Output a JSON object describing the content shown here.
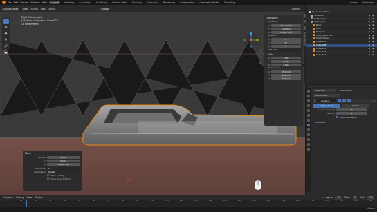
{
  "topbar": {
    "menus": [
      "File",
      "Edit",
      "Render",
      "Window",
      "Help"
    ],
    "workspaces": [
      "Layout",
      "Modeling",
      "Sculpting",
      "UV Editing",
      "Texture Paint",
      "Shading",
      "Animation",
      "Rendering",
      "Compositing",
      "Geometry Nodes",
      "Scripting"
    ],
    "active_workspace": "Layout",
    "scene": "Scene",
    "view_layer": "ViewLayer"
  },
  "viewport_header": {
    "mode": "Object Mode",
    "menus": [
      "View",
      "Select",
      "Add",
      "Object"
    ],
    "orientation": "Global",
    "options": "Options"
  },
  "viewport": {
    "view_name": "Right Orthographic",
    "collection": "(15) Scene Collection | Cube.008",
    "scale": "10 Centimeters"
  },
  "npanel": {
    "transform_title": "Transform",
    "location_label": "Location",
    "location": [
      {
        "axis": "X",
        "value": "-218.71 mm"
      },
      {
        "axis": "Y",
        "value": "-1.935 m"
      },
      {
        "axis": "Z",
        "value": "1208.7 mm"
      }
    ],
    "rotation_label": "Rotation",
    "rotation": [
      {
        "axis": "X",
        "value": "0°"
      },
      {
        "axis": "Y",
        "value": "0°"
      },
      {
        "axis": "Z",
        "value": "0°"
      }
    ],
    "rotation_mode": "XYZ Euler",
    "scale_label": "Scale",
    "scale": [
      {
        "axis": "X",
        "value": "1.867"
      },
      {
        "axis": "Y",
        "value": "0.788"
      },
      {
        "axis": "Z",
        "value": "2.666"
      }
    ],
    "dimensions_label": "Dimensions",
    "dimensions": [
      {
        "axis": "X",
        "value": "38.7 mm"
      },
      {
        "axis": "Y",
        "value": "120 mm"
      },
      {
        "axis": "Z",
        "value": "253 mm"
      }
    ],
    "tabs": [
      "Item",
      "Tool",
      "View",
      "Screencast Keys"
    ]
  },
  "move_panel": {
    "title": "Move",
    "fields": [
      {
        "label": "Move X",
        "value": "0 mm"
      },
      {
        "label": "Y",
        "value": "0 mm"
      },
      {
        "label": "Z",
        "value": "-104.01 mm"
      }
    ],
    "axis_ortho_label": "Axis Ortho",
    "axis_ortho_value": "X",
    "orientation_label": "Orientation",
    "orientation_value": "Global",
    "checks": [
      "Mirror Editing",
      "Proportional Editing"
    ]
  },
  "outliner": {
    "title": "Scene Collection",
    "items": [
      {
        "name": "Collection",
        "color": "#b0b0b0",
        "selected": false
      },
      {
        "name": "Ref_Images",
        "color": "#9a9a9a",
        "selected": false
      },
      {
        "name": "Ignore_Me",
        "color": "#9a9a9a",
        "selected": false
      },
      {
        "name": "Body",
        "color": "#e08a30",
        "selected": false
      },
      {
        "name": "Sofa",
        "color": "#e08a30",
        "selected": false
      },
      {
        "name": "Temp 2",
        "color": "#9a9a9a",
        "selected": false
      },
      {
        "name": "Front Lower Trim",
        "color": "#e08a30",
        "selected": false
      },
      {
        "name": "Front Frame",
        "color": "#e08a30",
        "selected": false
      },
      {
        "name": "Cube.020",
        "color": "#e08a30",
        "selected": false
      },
      {
        "name": "Cube.008",
        "color": "#e08a30",
        "selected": true
      },
      {
        "name": "Cube.011",
        "color": "#e08a30",
        "selected": false
      },
      {
        "name": "Cube.013",
        "color": "#e08a30",
        "selected": false
      },
      {
        "name": "Cube.014",
        "color": "#e08a30",
        "selected": false
      }
    ]
  },
  "properties": {
    "object_name": "Cube.008",
    "modifier_tab": "Subdivision",
    "add_modifier": "Add Modifier",
    "modifier_name": "Subdivis...",
    "catmull_clark": "Catmull-Clark",
    "simple": "Simple",
    "levels_viewport_label": "Levels Viewport",
    "levels_viewport": "3",
    "render_label": "Render",
    "render": "2",
    "optimal_display": "Optimal Display",
    "advanced": "Advanced"
  },
  "timeline": {
    "menus": [
      "Playback",
      "Keying",
      "View",
      "Marker"
    ],
    "current_frame": "15",
    "start_label": "Start",
    "start": "1",
    "end_label": "End",
    "end": "250",
    "ticks": [
      "0",
      "10",
      "20",
      "30",
      "40",
      "50",
      "60",
      "70",
      "80",
      "90",
      "100",
      "110",
      "120",
      "130",
      "140",
      "150",
      "160",
      "170",
      "180",
      "190",
      "200",
      "210",
      "220",
      "230",
      "240",
      "250"
    ]
  },
  "watermark": "Udemy",
  "colors": {
    "accent": "#4772b3",
    "selection_outline": "#e8891a",
    "floor": "#6e4c45",
    "object_fill": "#8a8a8a"
  }
}
